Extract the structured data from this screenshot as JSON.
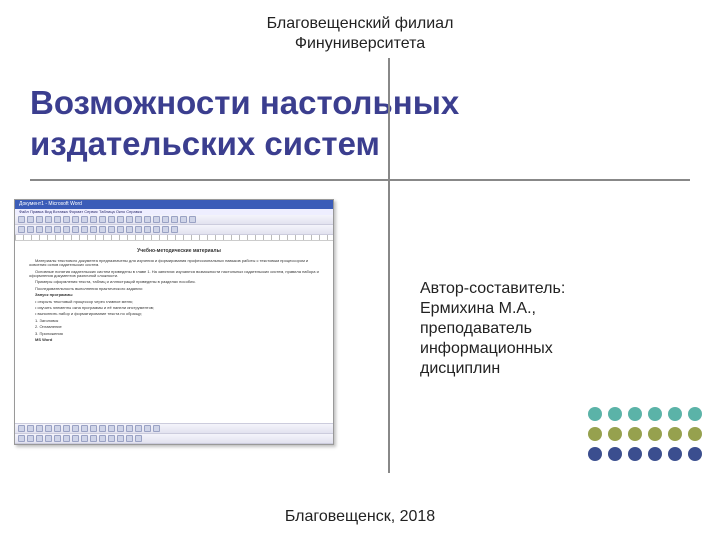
{
  "header": {
    "line1": "Благовещенский филиал",
    "line2": "Финуниверситета"
  },
  "title": {
    "line1": "Возможности настольных",
    "line2": "издательских систем"
  },
  "author": {
    "line1": "Автор-составитель:",
    "line2": "Ермихина М.А.,",
    "line3": "преподаватель",
    "line4": "информационных",
    "line5": "дисциплин"
  },
  "footer": "Благовещенск, 2018",
  "thumbnail": {
    "app_title": "Документ1 - Microsoft Word",
    "menu": "Файл  Правка  Вид  Вставка  Формат  Сервис  Таблица  Окно  Справка",
    "doc_heading": "Учебно-методические материалы",
    "program_label": "Запуск программы",
    "word_label": "MS Word"
  },
  "dot_colors": {
    "teal": "#5bb3a8",
    "olive": "#96a14e",
    "navy": "#3b4e8f"
  }
}
